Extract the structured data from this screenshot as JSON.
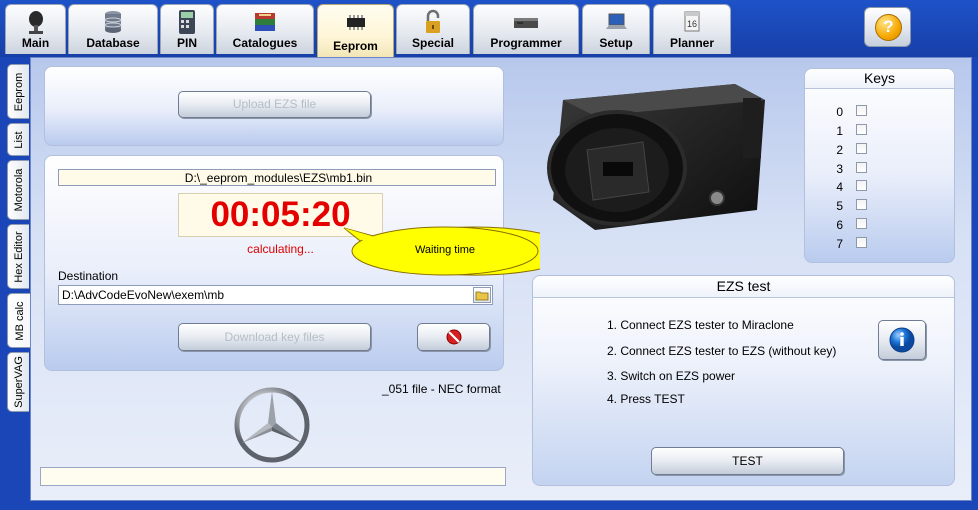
{
  "tabs": [
    {
      "label": "Main",
      "icon": "microphone-icon"
    },
    {
      "label": "Database",
      "icon": "database-icon"
    },
    {
      "label": "PIN",
      "icon": "calculator-icon"
    },
    {
      "label": "Catalogues",
      "icon": "books-icon"
    },
    {
      "label": "Eeprom",
      "icon": "chip-icon"
    },
    {
      "label": "Special",
      "icon": "padlock-icon"
    },
    {
      "label": "Programmer",
      "icon": "programmer-device-icon"
    },
    {
      "label": "Setup",
      "icon": "laptop-icon"
    },
    {
      "label": "Planner",
      "icon": "calendar-icon"
    }
  ],
  "active_tab": "Eeprom",
  "help_button": {
    "label": "?",
    "icon": "help-icon"
  },
  "side_tabs": [
    {
      "label": "Eeprom"
    },
    {
      "label": "List"
    },
    {
      "label": "Motorola"
    },
    {
      "label": "Hex Editor"
    },
    {
      "label": "MB calc"
    },
    {
      "label": "SuperVAG"
    }
  ],
  "active_side_tab": "MB calc",
  "upload": {
    "button_label": "Upload EZS file"
  },
  "file_path": "D:\\_eeprom_modules\\EZS\\mb1.bin",
  "timer": {
    "value": "00:05:20",
    "status": "calculating...",
    "callout": "Waiting time"
  },
  "destination": {
    "label": "Destination",
    "value": "D:\\AdvCodeEvoNew\\exem\\mb",
    "browse_icon": "folder-icon"
  },
  "download": {
    "button_label": "Download key files",
    "cancel_icon": "stop-icon"
  },
  "format_note": "_051 file - NEC format",
  "logo": "mercedes-star-logo",
  "product_image": "ezs-module-image",
  "keys": {
    "title": "Keys",
    "items": [
      "0",
      "1",
      "2",
      "3",
      "4",
      "5",
      "6",
      "7"
    ]
  },
  "ezs_test": {
    "title": "EZS test",
    "steps": [
      "1. Connect EZS tester to Miraclone",
      "2. Connect EZS tester to EZS (without key)",
      "3. Switch on EZS power",
      "4. Press TEST"
    ],
    "info_icon": "info-icon",
    "test_button": "TEST"
  },
  "colors": {
    "timer_red": "#e50000",
    "status_red": "#e00000",
    "callout_yellow": "#ffff00",
    "frame_blue": "#1a46b8",
    "info_blue": "#1b74d8"
  }
}
